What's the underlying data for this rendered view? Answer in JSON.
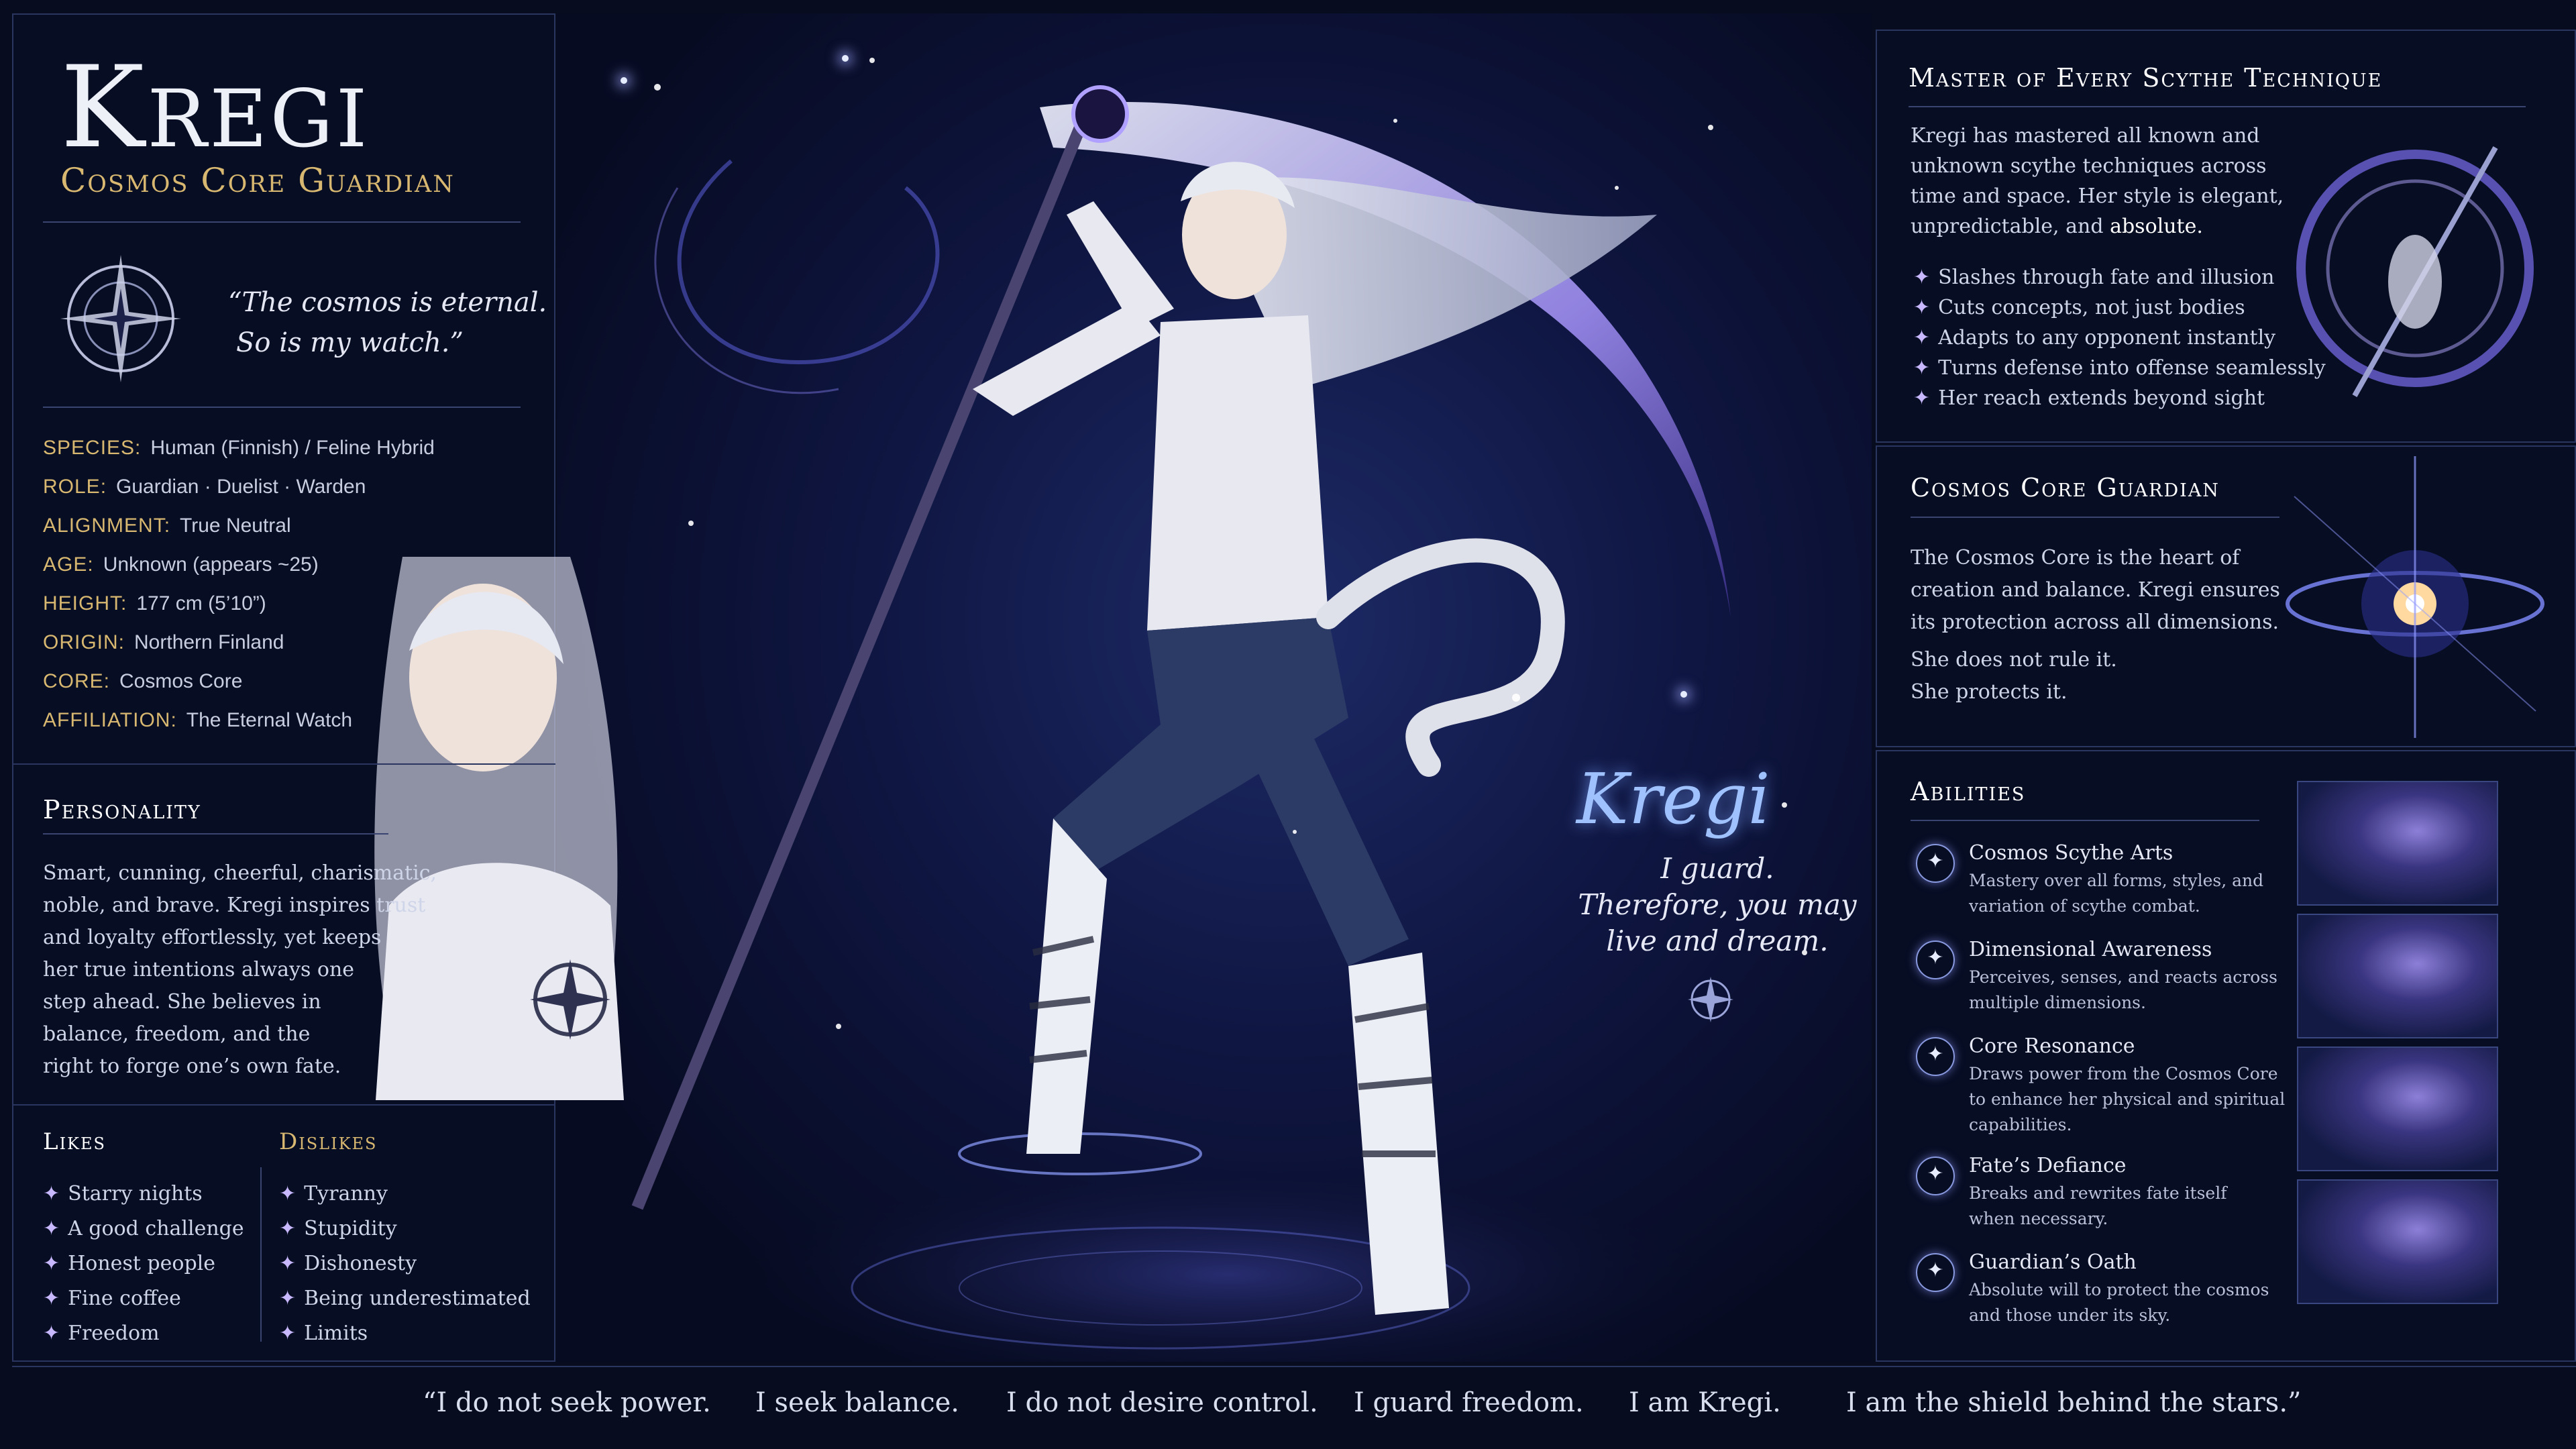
{
  "header": {
    "name": "Kregi",
    "subtitle": "Cosmos Core Guardian"
  },
  "emblem_quote": {
    "line1": "“The cosmos is eternal.",
    "line2": "So is my watch.”"
  },
  "profile": [
    {
      "key": "SPECIES:",
      "value": "Human (Finnish) / Feline Hybrid"
    },
    {
      "key": "ROLE:",
      "value": "Guardian · Duelist · Warden"
    },
    {
      "key": "ALIGNMENT:",
      "value": "True Neutral"
    },
    {
      "key": "AGE:",
      "value": "Unknown (appears ~25)"
    },
    {
      "key": "HEIGHT:",
      "value": "177 cm (5’10”)"
    },
    {
      "key": "ORIGIN:",
      "value": "Northern Finland"
    },
    {
      "key": "CORE:",
      "value": "Cosmos Core"
    },
    {
      "key": "AFFILIATION:",
      "value": "The Eternal Watch"
    }
  ],
  "personality": {
    "title": "Personality",
    "lines": [
      "Smart, cunning, cheerful, charismatic,",
      "noble, and brave. Kregi inspires trust",
      "and loyalty effortlessly, yet keeps",
      "her true intentions always one",
      "step ahead. She believes in",
      "balance, freedom, and the",
      "right to forge one’s own fate."
    ]
  },
  "likes": {
    "title": "Likes",
    "items": [
      "Starry nights",
      "A good challenge",
      "Honest people",
      "Fine coffee",
      "Freedom"
    ]
  },
  "dislikes": {
    "title": "Dislikes",
    "items": [
      "Tyranny",
      "Stupidity",
      "Dishonesty",
      "Being underestimated",
      "Limits"
    ]
  },
  "scene": {
    "signature": "Kregi",
    "motto": [
      "I guard.",
      "Therefore, you may",
      "live and dream."
    ]
  },
  "scythe": {
    "title": "Master of Every Scythe Technique",
    "lines": [
      "Kregi has mastered all known and",
      "unknown scythe techniques across",
      "time and space. Her style is elegant,",
      "unpredictable, and"
    ],
    "emphasis": "absolute.",
    "bullets": [
      "Slashes through fate and illusion",
      "Cuts concepts, not just bodies",
      "Adapts to any opponent instantly",
      "Turns defense into offense seamlessly",
      "Her reach extends beyond sight"
    ]
  },
  "core": {
    "title": "Cosmos Core Guardian",
    "lines": [
      "The Cosmos Core is the heart of",
      "creation and balance. Kregi ensures",
      "its protection across all dimensions."
    ],
    "lines2": [
      "She does not rule it.",
      "She protects it."
    ]
  },
  "abilities": {
    "title": "Abilities",
    "items": [
      {
        "name": "Cosmos Scythe Arts",
        "desc": [
          "Mastery over all forms, styles, and",
          "variation of scythe combat."
        ]
      },
      {
        "name": "Dimensional Awareness",
        "desc": [
          "Perceives, senses, and reacts across",
          "multiple dimensions."
        ]
      },
      {
        "name": "Core Resonance",
        "desc": [
          "Draws power from the Cosmos Core",
          "to enhance her physical and spiritual",
          "capabilities."
        ]
      },
      {
        "name": "Fate’s Defiance",
        "desc": [
          "Breaks and rewrites fate itself",
          "when necessary."
        ]
      },
      {
        "name": "Guardian’s Oath",
        "desc": [
          "Absolute will to protect the cosmos",
          "and those under its sky."
        ]
      }
    ]
  },
  "footer_quote": [
    "“I do not seek power.",
    "I seek balance.",
    "I do not desire control.",
    "I guard freedom.",
    "I am Kregi.",
    "I am the shield behind the stars.”"
  ],
  "colors": {
    "background": "#070c1f",
    "gold": "#d8b870",
    "accent": "#8a7cff",
    "border": "#2a3560"
  },
  "icons": {
    "emblem": "compass-star-emblem-icon",
    "bullet": "sparkle-icon",
    "ability": "star-orb-icon"
  }
}
